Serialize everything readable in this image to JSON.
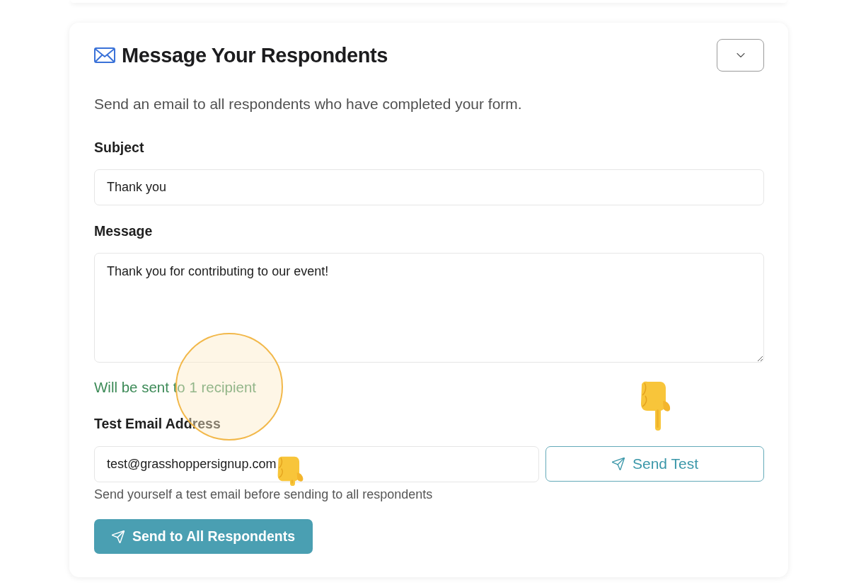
{
  "header": {
    "title": "Message Your Respondents",
    "expanded": true
  },
  "description": "Send an email to all respondents who have completed your form.",
  "subject": {
    "label": "Subject",
    "value": "Thank you"
  },
  "message": {
    "label": "Message",
    "value": "Thank you for contributing to our event!"
  },
  "recipient_note": "Will be sent to 1 recipient",
  "test_email": {
    "label": "Test Email Address",
    "value": "test@grasshoppersignup.com",
    "button": "Send Test",
    "hint": "Send yourself a test email before sending to all respondents"
  },
  "send_all_button": "Send to All Respondents"
}
